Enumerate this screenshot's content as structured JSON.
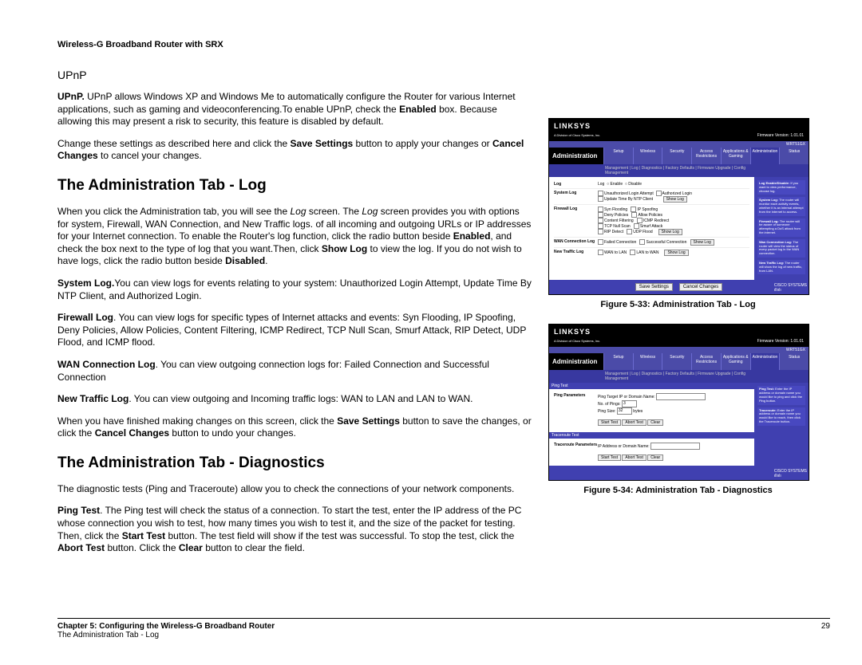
{
  "header": "Wireless-G Broadband Router with SRX",
  "upnp": {
    "title": "UPnP",
    "para": "UPnP. UPnP allows Windows XP and Windows Me to automatically configure the Router for various Internet applications, such as gaming and videoconferencing.To enable UPnP, check the Enabled box. Because allowing this may present a risk to security, this feature is disabled by default.",
    "para2": "Change these settings as described here and click the Save Settings button to apply your changes or Cancel Changes to cancel your changes."
  },
  "log": {
    "title": "The Administration Tab - Log",
    "p1": "When you click the Administration tab, you will see the Log screen. The Log screen provides you with options for system, Firewall, WAN Connection, and New Traffic logs. of all incoming and outgoing URLs or IP addresses for your Internet connection. To enable the Router's log function, click the radio button beside Enabled, and check the box next to the type of log that you want.Then, click Show Log to view the log. If you do not wish to have logs, click the radio button beside Disabled.",
    "p2": "System Log.You can view logs for events relating to your system: Unauthorized Login Attempt, Update Time By NTP Client, and Authorized Login.",
    "p3": "Firewall Log. You can view logs for specific types of Internet attacks and events: Syn Flooding, IP Spoofing, Deny Policies, Allow Policies, Content Filtering, ICMP Redirect, TCP Null Scan, Smurf Attack, RIP Detect, UDP Flood, and ICMP flood.",
    "p4": "WAN Connection Log. You can view outgoing connection logs for: Failed Connection and Successful Connection",
    "p5": "New Traffic Log. You can view outgoing and Incoming traffic logs: WAN to LAN and LAN to WAN.",
    "p6": "When you have finished making changes on this screen, click the Save Settings button to save the changes, or click the Cancel Changes button to undo your changes."
  },
  "diag": {
    "title": "The Administration Tab - Diagnostics",
    "p1": "The diagnostic tests (Ping and Traceroute) allow you to check the connections of your network components.",
    "p2": "Ping Test. The Ping test will check the status of a connection. To start the test, enter the IP address of the PC whose connection you wish to test, how many times you wish to test it, and the size of the packet for testing. Then, click the Start Test button. The test field will show if the test was successful. To stop the test, click the Abort Test button. Click the Clear button to clear the field."
  },
  "fig1": {
    "caption": "Figure 5-33: Administration Tab - Log",
    "brand": "LINKSYS",
    "subbrand": "A Division of Cisco Systems, Inc.",
    "fw": "Firmware Version: 1.01.01",
    "model": "WRT51GX",
    "navtitle": "Administration",
    "tabs": [
      "Setup",
      "Wireless",
      "Security",
      "Access Restrictions",
      "Applications & Gaming",
      "Administration",
      "Status"
    ],
    "subnav": "Management  |  Log  |  Diagnostics  |  Factory Defaults  |  Firmware Upgrade  |  Config Management",
    "rows": {
      "log": {
        "label": "Log",
        "opts": [
          "Enable",
          "Disable"
        ]
      },
      "syslog": {
        "label": "System Log",
        "opts": [
          "Unauthorized Login Attempt",
          "Authorized Login",
          "Update Time By NTP Client"
        ],
        "btn": "Show Log"
      },
      "fwlog": {
        "label": "Firewall Log",
        "opts": [
          "Syn Flooding",
          "IP Spoofing",
          "Deny Policies",
          "Allow Policies",
          "Content Filtering",
          "ICMP Redirect",
          "TCP Null Scan",
          "Smurf Attack",
          "RIP Detect",
          "UDP Flood"
        ],
        "btn": "Show Log"
      },
      "wanlog": {
        "label": "WAN Connection Log",
        "opts": [
          "Failed Connection",
          "Successful Connection"
        ],
        "btn": "Show Log"
      },
      "ntlog": {
        "label": "New Traffic Log",
        "opts": [
          "WAN to LAN",
          "LAN to WAN"
        ],
        "btn": "Show Log"
      }
    },
    "side": [
      {
        "t": "Log Enable/Disable:",
        "d": "If you want to view performance, choose log."
      },
      {
        "t": "System Log:",
        "d": "The router will monitor each activity events, whether it is an internal attempt from the internet to access."
      },
      {
        "t": "Firewall Log:",
        "d": "The router will be aware of someone attempting a DoS attack from the internet."
      },
      {
        "t": "Wan Connection Log:",
        "d": "The router will view the status of every packet log in the WAN connection."
      },
      {
        "t": "New Traffic Log:",
        "d": "The router will show the log of new traffic, from LAN."
      }
    ],
    "save": "Save Settings",
    "cancel": "Cancel Changes"
  },
  "fig2": {
    "caption": "Figure 5-34: Administration Tab - Diagnostics",
    "brand": "LINKSYS",
    "subbrand": "A Division of Cisco Systems, Inc.",
    "fw": "Firmware Version: 1.01.01",
    "model": "WRT51GX",
    "navtitle": "Administration",
    "tabs": [
      "Setup",
      "Wireless",
      "Security",
      "Access Restrictions",
      "Applications & Gaming",
      "Administration",
      "Status"
    ],
    "subnav": "Management  |  Log  |  Diagnostics  |  Factory Defaults  |  Firmware Upgrade  |  Config Management",
    "ping": {
      "header": "Ping Test",
      "label": "Ping Parameters",
      "f1": "Ping Target IP or Domain Name:",
      "f2": "No. of Pings:",
      "v2": "3",
      "f3": "Ping Size:",
      "v3": "32",
      "u3": "bytes",
      "b1": "Start Test",
      "b2": "Abort Test",
      "b3": "Clear"
    },
    "trace": {
      "header": "Traceroute Test",
      "label": "Traceroute Parameters",
      "f1": "IP Address or Domain Name:",
      "b1": "Start Test",
      "b2": "Abort Test",
      "b3": "Clear"
    },
    "side": [
      {
        "t": "Ping Test:",
        "d": "Enter the IP address or domain name you would like to ping and click the Ping button."
      },
      {
        "t": "Traceroute:",
        "d": "Enter the IP address or domain name you would like to reach, then click the Traceroute button."
      }
    ]
  },
  "footer": {
    "chapter": "Chapter 5: Configuring the Wireless-G Broadband Router",
    "sub": "The Administration Tab - Log",
    "page": "29"
  }
}
